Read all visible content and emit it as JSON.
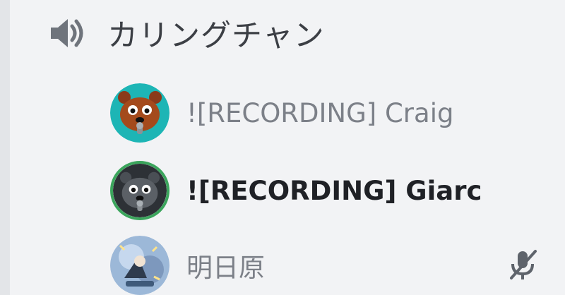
{
  "channel": {
    "icon": "speaker-icon",
    "name": "カリングチャン"
  },
  "users": [
    {
      "name": "![RECORDING] Craig",
      "avatar": "craig-bear-avatar",
      "speaking": false,
      "muted": false
    },
    {
      "name": "![RECORDING] Giarc",
      "avatar": "giarc-bear-avatar",
      "speaking": true,
      "muted": false
    },
    {
      "name": "明日原",
      "avatar": "anime-avatar",
      "speaking": false,
      "muted": true,
      "status_icon": "mic-muted-icon"
    }
  ],
  "colors": {
    "background": "#f2f3f5",
    "speaking_ring": "#3ba55c",
    "muted_text": "#7c8088",
    "active_text": "#1f2126"
  }
}
